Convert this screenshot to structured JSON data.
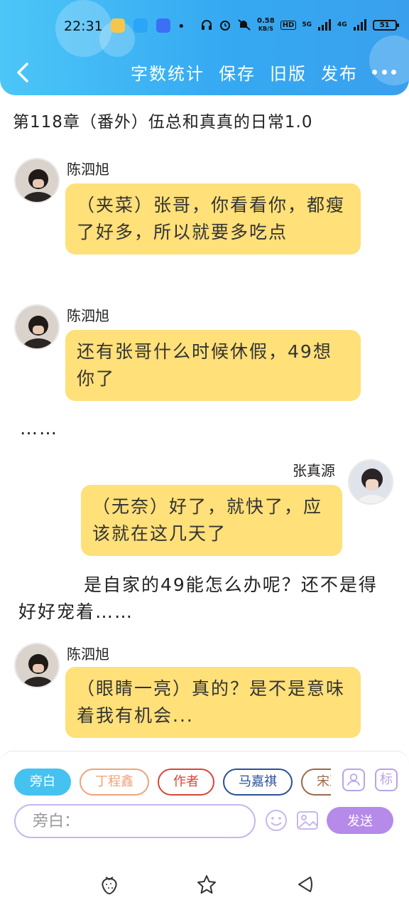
{
  "status_bar": {
    "time": "22:31",
    "dot": "•",
    "net_speed_value": "0.58",
    "net_speed_unit": "KB/S",
    "hd_badge": "HD",
    "signal1_label": "5G",
    "signal2_label": "4G",
    "battery": "51",
    "app_icons": [
      "wechat-like-icon",
      "qq-icon",
      "baidu-icon"
    ],
    "app_icon_colors": [
      "#f6c64a",
      "#2aa5f7",
      "#3b6ff5"
    ]
  },
  "nav": {
    "actions": [
      "字数统计",
      "保存",
      "旧版",
      "发布"
    ]
  },
  "chapter_title": "第118章（番外）伍总和真真的日常1.0",
  "messages": [
    {
      "speaker": "陈泗旭",
      "text": "（夹菜）张哥，你看看你，都瘦了好多，所以就要多吃点"
    },
    {
      "speaker": "陈泗旭",
      "text": "还有张哥什么时候休假，49想你了"
    },
    {
      "narration": "……"
    },
    {
      "speaker": "张真源",
      "text": "（无奈）好了，就快了，应该就在这几天了"
    },
    {
      "narration": "是自家的49能怎么办呢？还不是得好好宠着……"
    },
    {
      "speaker": "陈泗旭",
      "text": "（眼睛一亮）真的？是不是意味着我有机会..."
    }
  ],
  "composer": {
    "chips": [
      {
        "label": "旁白",
        "active": true,
        "color": "#45c2f0"
      },
      {
        "label": "丁程鑫",
        "active": false,
        "color": "#f0a27c"
      },
      {
        "label": "作者",
        "active": false,
        "color": "#d8453c"
      },
      {
        "label": "马嘉祺",
        "active": false,
        "color": "#2b4f9a"
      },
      {
        "label": "宋亚轩",
        "active": false,
        "color": "#9a6a4a"
      }
    ],
    "mark_label": "标",
    "input_placeholder": "旁白：",
    "send_label": "发送",
    "accent_color": "#b58ae8"
  },
  "colors": {
    "topbar": "#3aa9f2",
    "bubble": "#ffe079"
  }
}
